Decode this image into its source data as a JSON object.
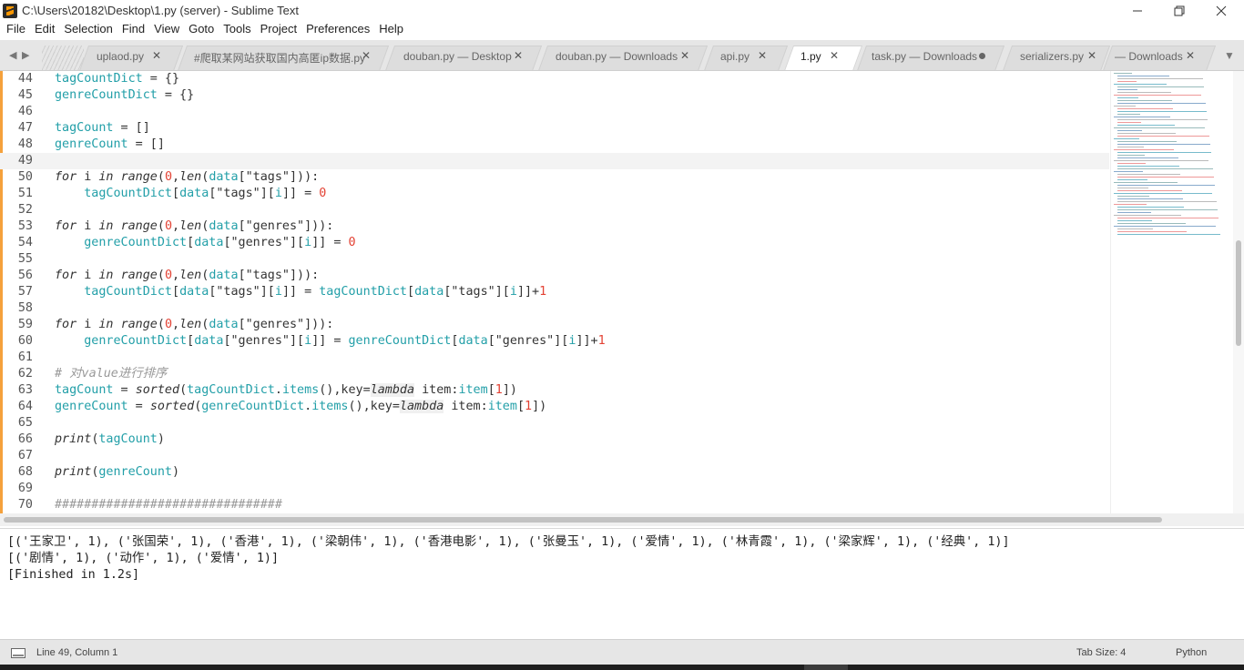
{
  "window": {
    "title": "C:\\Users\\20182\\Desktop\\1.py (server) - Sublime Text"
  },
  "menu": [
    "File",
    "Edit",
    "Selection",
    "Find",
    "View",
    "Goto",
    "Tools",
    "Project",
    "Preferences",
    "Help"
  ],
  "tabs": [
    {
      "label": "uplaod.py",
      "active": false,
      "dirty": false
    },
    {
      "label": "#爬取某网站获取国内高匿ip数据.py",
      "active": false,
      "dirty": false
    },
    {
      "label": "douban.py — Desktop",
      "active": false,
      "dirty": false
    },
    {
      "label": "douban.py — Downloads",
      "active": false,
      "dirty": false
    },
    {
      "label": "api.py",
      "active": false,
      "dirty": false
    },
    {
      "label": "1.py",
      "active": true,
      "dirty": false
    },
    {
      "label": "task.py — Downloads",
      "active": false,
      "dirty": true
    },
    {
      "label": "serializers.py",
      "active": false,
      "dirty": false
    },
    {
      "label": "— Downloads",
      "active": false,
      "dirty": false
    }
  ],
  "editor": {
    "current_line": 49,
    "lines": [
      {
        "n": "44",
        "tokens": [
          [
            "var",
            "tagCountDict"
          ],
          [
            "op",
            " = {}"
          ]
        ]
      },
      {
        "n": "45",
        "tokens": [
          [
            "var",
            "genreCountDict"
          ],
          [
            "op",
            " = {}"
          ]
        ]
      },
      {
        "n": "46",
        "tokens": []
      },
      {
        "n": "47",
        "tokens": [
          [
            "var",
            "tagCount"
          ],
          [
            "op",
            " = []"
          ]
        ]
      },
      {
        "n": "48",
        "tokens": [
          [
            "var",
            "genreCount"
          ],
          [
            "op",
            " = []"
          ]
        ]
      },
      {
        "n": "49",
        "tokens": []
      },
      {
        "n": "50",
        "tokens": [
          [
            "kw",
            "for"
          ],
          [
            "op",
            " i "
          ],
          [
            "kw",
            "in"
          ],
          [
            "op",
            " "
          ],
          [
            "fn",
            "range"
          ],
          [
            "op",
            "("
          ],
          [
            "num",
            "0"
          ],
          [
            "op",
            ","
          ],
          [
            "fn",
            "len"
          ],
          [
            "op",
            "("
          ],
          [
            "var",
            "data"
          ],
          [
            "op",
            "["
          ],
          [
            "str",
            "\"tags\""
          ],
          [
            "op",
            "])):"
          ]
        ]
      },
      {
        "n": "51",
        "tokens": [
          [
            "op",
            "    "
          ],
          [
            "var",
            "tagCountDict"
          ],
          [
            "op",
            "["
          ],
          [
            "var",
            "data"
          ],
          [
            "op",
            "["
          ],
          [
            "str",
            "\"tags\""
          ],
          [
            "op",
            "]["
          ],
          [
            "var",
            "i"
          ],
          [
            "op",
            "]] = "
          ],
          [
            "num",
            "0"
          ]
        ]
      },
      {
        "n": "52",
        "tokens": []
      },
      {
        "n": "53",
        "tokens": [
          [
            "kw",
            "for"
          ],
          [
            "op",
            " i "
          ],
          [
            "kw",
            "in"
          ],
          [
            "op",
            " "
          ],
          [
            "fn",
            "range"
          ],
          [
            "op",
            "("
          ],
          [
            "num",
            "0"
          ],
          [
            "op",
            ","
          ],
          [
            "fn",
            "len"
          ],
          [
            "op",
            "("
          ],
          [
            "var",
            "data"
          ],
          [
            "op",
            "["
          ],
          [
            "str",
            "\"genres\""
          ],
          [
            "op",
            "])):"
          ]
        ]
      },
      {
        "n": "54",
        "tokens": [
          [
            "op",
            "    "
          ],
          [
            "var",
            "genreCountDict"
          ],
          [
            "op",
            "["
          ],
          [
            "var",
            "data"
          ],
          [
            "op",
            "["
          ],
          [
            "str",
            "\"genres\""
          ],
          [
            "op",
            "]["
          ],
          [
            "var",
            "i"
          ],
          [
            "op",
            "]] = "
          ],
          [
            "num",
            "0"
          ]
        ]
      },
      {
        "n": "55",
        "tokens": []
      },
      {
        "n": "56",
        "tokens": [
          [
            "kw",
            "for"
          ],
          [
            "op",
            " i "
          ],
          [
            "kw",
            "in"
          ],
          [
            "op",
            " "
          ],
          [
            "fn",
            "range"
          ],
          [
            "op",
            "("
          ],
          [
            "num",
            "0"
          ],
          [
            "op",
            ","
          ],
          [
            "fn",
            "len"
          ],
          [
            "op",
            "("
          ],
          [
            "var",
            "data"
          ],
          [
            "op",
            "["
          ],
          [
            "str",
            "\"tags\""
          ],
          [
            "op",
            "])):"
          ]
        ]
      },
      {
        "n": "57",
        "tokens": [
          [
            "op",
            "    "
          ],
          [
            "var",
            "tagCountDict"
          ],
          [
            "op",
            "["
          ],
          [
            "var",
            "data"
          ],
          [
            "op",
            "["
          ],
          [
            "str",
            "\"tags\""
          ],
          [
            "op",
            "]["
          ],
          [
            "var",
            "i"
          ],
          [
            "op",
            "]] = "
          ],
          [
            "var",
            "tagCountDict"
          ],
          [
            "op",
            "["
          ],
          [
            "var",
            "data"
          ],
          [
            "op",
            "["
          ],
          [
            "str",
            "\"tags\""
          ],
          [
            "op",
            "]["
          ],
          [
            "var",
            "i"
          ],
          [
            "op",
            "]]+"
          ],
          [
            "num",
            "1"
          ]
        ]
      },
      {
        "n": "58",
        "tokens": []
      },
      {
        "n": "59",
        "tokens": [
          [
            "kw",
            "for"
          ],
          [
            "op",
            " i "
          ],
          [
            "kw",
            "in"
          ],
          [
            "op",
            " "
          ],
          [
            "fn",
            "range"
          ],
          [
            "op",
            "("
          ],
          [
            "num",
            "0"
          ],
          [
            "op",
            ","
          ],
          [
            "fn",
            "len"
          ],
          [
            "op",
            "("
          ],
          [
            "var",
            "data"
          ],
          [
            "op",
            "["
          ],
          [
            "str",
            "\"genres\""
          ],
          [
            "op",
            "])):"
          ]
        ]
      },
      {
        "n": "60",
        "tokens": [
          [
            "op",
            "    "
          ],
          [
            "var",
            "genreCountDict"
          ],
          [
            "op",
            "["
          ],
          [
            "var",
            "data"
          ],
          [
            "op",
            "["
          ],
          [
            "str",
            "\"genres\""
          ],
          [
            "op",
            "]["
          ],
          [
            "var",
            "i"
          ],
          [
            "op",
            "]] = "
          ],
          [
            "var",
            "genreCountDict"
          ],
          [
            "op",
            "["
          ],
          [
            "var",
            "data"
          ],
          [
            "op",
            "["
          ],
          [
            "str",
            "\"genres\""
          ],
          [
            "op",
            "]["
          ],
          [
            "var",
            "i"
          ],
          [
            "op",
            "]]+"
          ],
          [
            "num",
            "1"
          ]
        ]
      },
      {
        "n": "61",
        "tokens": []
      },
      {
        "n": "62",
        "tokens": [
          [
            "cm",
            "# 对value进行排序"
          ]
        ]
      },
      {
        "n": "63",
        "tokens": [
          [
            "var",
            "tagCount"
          ],
          [
            "op",
            " = "
          ],
          [
            "fn",
            "sorted"
          ],
          [
            "op",
            "("
          ],
          [
            "var",
            "tagCountDict"
          ],
          [
            "op",
            "."
          ],
          [
            "var",
            "items"
          ],
          [
            "op",
            "(),key="
          ],
          [
            "lam",
            "lambda"
          ],
          [
            "op",
            " item:"
          ],
          [
            "var",
            "item"
          ],
          [
            "op",
            "["
          ],
          [
            "num",
            "1"
          ],
          [
            "op",
            "])"
          ]
        ]
      },
      {
        "n": "64",
        "tokens": [
          [
            "var",
            "genreCount"
          ],
          [
            "op",
            " = "
          ],
          [
            "fn",
            "sorted"
          ],
          [
            "op",
            "("
          ],
          [
            "var",
            "genreCountDict"
          ],
          [
            "op",
            "."
          ],
          [
            "var",
            "items"
          ],
          [
            "op",
            "(),key="
          ],
          [
            "lam",
            "lambda"
          ],
          [
            "op",
            " item:"
          ],
          [
            "var",
            "item"
          ],
          [
            "op",
            "["
          ],
          [
            "num",
            "1"
          ],
          [
            "op",
            "])"
          ]
        ]
      },
      {
        "n": "65",
        "tokens": []
      },
      {
        "n": "66",
        "tokens": [
          [
            "fn",
            "print"
          ],
          [
            "op",
            "("
          ],
          [
            "var",
            "tagCount"
          ],
          [
            "op",
            ")"
          ]
        ]
      },
      {
        "n": "67",
        "tokens": []
      },
      {
        "n": "68",
        "tokens": [
          [
            "fn",
            "print"
          ],
          [
            "op",
            "("
          ],
          [
            "var",
            "genreCount"
          ],
          [
            "op",
            ")"
          ]
        ]
      },
      {
        "n": "69",
        "tokens": []
      },
      {
        "n": "70",
        "tokens": [
          [
            "cm",
            "###############################"
          ]
        ]
      }
    ]
  },
  "output": {
    "lines": [
      "[('王家卫', 1), ('张国荣', 1), ('香港', 1), ('梁朝伟', 1), ('香港电影', 1), ('张曼玉', 1), ('爱情', 1), ('林青霞', 1), ('梁家辉', 1), ('经典', 1)]",
      "[('剧情', 1), ('动作', 1), ('爱情', 1)]",
      "[Finished in 1.2s]"
    ]
  },
  "status": {
    "position": "Line 49, Column 1",
    "tab_size": "Tab Size: 4",
    "syntax": "Python"
  },
  "colors": {
    "accent_modified": "#f5a13c",
    "variable": "#229fa8",
    "number": "#e34234",
    "comment": "#999999"
  }
}
